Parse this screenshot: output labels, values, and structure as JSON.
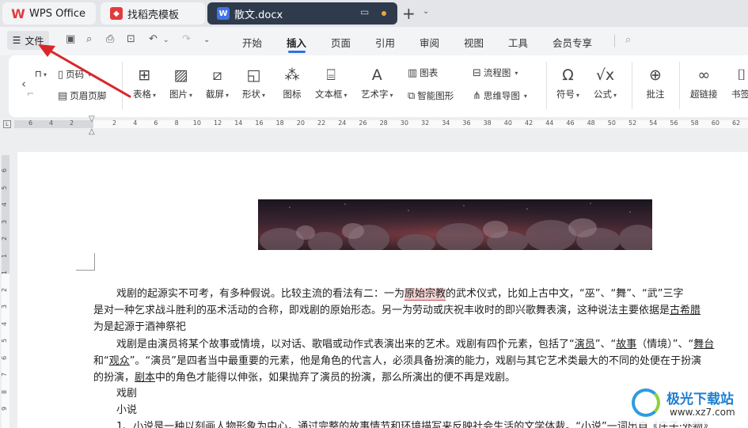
{
  "tabs": {
    "wps": "WPS Office",
    "template": "找稻壳模板",
    "document": "散文.docx"
  },
  "menu": {
    "file": "文件",
    "items": [
      "开始",
      "插入",
      "页面",
      "引用",
      "审阅",
      "视图",
      "工具",
      "会员专享"
    ],
    "active": "插入"
  },
  "ribbon": {
    "header_label": "页码",
    "header_footer": "页眉页脚",
    "table": "表格",
    "picture": "图片",
    "screenshot": "截屏",
    "shape": "形状",
    "icon": "图标",
    "textbox": "文本框",
    "wordart": "艺术字",
    "chart": "图表",
    "smartart": "智能图形",
    "flowchart": "流程图",
    "mindmap": "思维导图",
    "symbol": "符号",
    "formula": "公式",
    "comment": "批注",
    "hyperlink": "超链接",
    "bookmark": "书签"
  },
  "ruler": {
    "h_left": [
      "6",
      "4",
      "2"
    ],
    "h_right": [
      "2",
      "4",
      "6",
      "8",
      "10",
      "12",
      "14",
      "16",
      "18",
      "20",
      "22",
      "24",
      "26",
      "28",
      "30",
      "32",
      "34",
      "36",
      "38",
      "40",
      "42",
      "44",
      "46",
      "48",
      "50",
      "52",
      "54",
      "56",
      "58",
      "60",
      "62"
    ],
    "v": [
      "6",
      "5",
      "4",
      "3",
      "2",
      "1",
      "1",
      "2",
      "3",
      "4",
      "5",
      "6",
      "7",
      "8",
      "9"
    ]
  },
  "document": {
    "p1a": "戏剧的起源实不可考，有多种假说。比较主流的看法有二：一为",
    "p1_highlight": "原始宗教",
    "p1b": "的武术仪式，比如上古中文，“巫”、“舞”、“武”三字",
    "p2a": "是对一种乞求战斗胜利的巫术活动的合称，即戏剧的原始形态。另一为劳动或庆祝丰收时的即兴歌舞表演，这种说法主要依据是",
    "p2_link": "古希腊",
    "p3": "为是起源于酒神祭祀",
    "p4a": "戏剧是由演员将某个故事或情境，以对话、歌唱或动作式表演出来的艺术。戏剧有四个元素，包括了“",
    "p4_actor": "演员",
    "p4b": "”、“",
    "p4_story": "故事",
    "p4c": "（情境）”、“",
    "p4_stage": "舞台",
    "p5a": "和“",
    "p5_audience": "观众",
    "p5b": "”。“演员”是四者当中最重要的元素，他是角色的代言人，必须具备扮演的能力，戏剧与其它艺术类最大的不同的处便在于扮演",
    "p6a": "的扮演，",
    "p6_script": "剧本",
    "p6b": "中的角色才能得以伸张，如果抛弃了演员的扮演，那么所演出的便不再是戏剧。",
    "h1": "戏剧",
    "h2": "小说",
    "p7": "1、小说是一种以刻画人物形象为中心，通过完整的故事情节和环境描写来反映社会生活的文学体裁。“小说”一词出自《庄子·外物》"
  },
  "watermark": {
    "title": "极光下载站",
    "url": "www.xz7.com"
  },
  "colors": {
    "accent": "#2d72e0",
    "arrow": "#d9262b",
    "active_tab": "#2f3b4c"
  }
}
